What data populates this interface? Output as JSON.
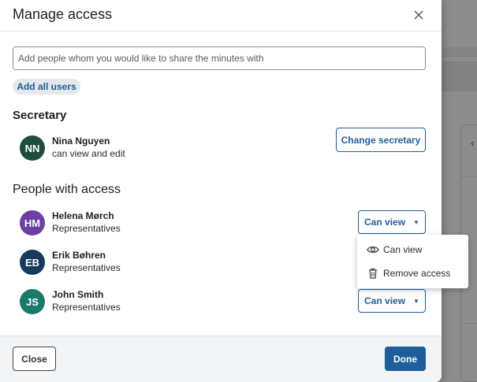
{
  "modal": {
    "title": "Manage access",
    "share_input": {
      "value": "",
      "placeholder": "Add people whom you would like to share the minutes with"
    },
    "add_all_users_label": "Add all users"
  },
  "secretary": {
    "section_title": "Secretary",
    "initials": "NN",
    "name": "Nina Nguyen",
    "role": "can view and edit",
    "avatar_color": "#1e4d3b",
    "change_button_label": "Change secretary"
  },
  "people": {
    "section_title": "People with access",
    "list": [
      {
        "initials": "HM",
        "name": "Helena Mørch",
        "group": "Representatives",
        "avatar_color": "#6b3fa3",
        "permission": "Can view"
      },
      {
        "initials": "EB",
        "name": "Erik Bøhren",
        "group": "Representatives",
        "avatar_color": "#153a5c",
        "permission": ""
      },
      {
        "initials": "JS",
        "name": "John Smith",
        "group": "Representatives",
        "avatar_color": "#1a7a6a",
        "permission": "Can view"
      }
    ]
  },
  "permission_menu": {
    "items": [
      {
        "label": "Can view",
        "icon": "eye-icon"
      },
      {
        "label": "Remove access",
        "icon": "trash-icon"
      }
    ]
  },
  "footer": {
    "close_label": "Close",
    "done_label": "Done"
  },
  "colors": {
    "primary": "#1f5f99",
    "chip_bg": "#e4e8ed"
  }
}
